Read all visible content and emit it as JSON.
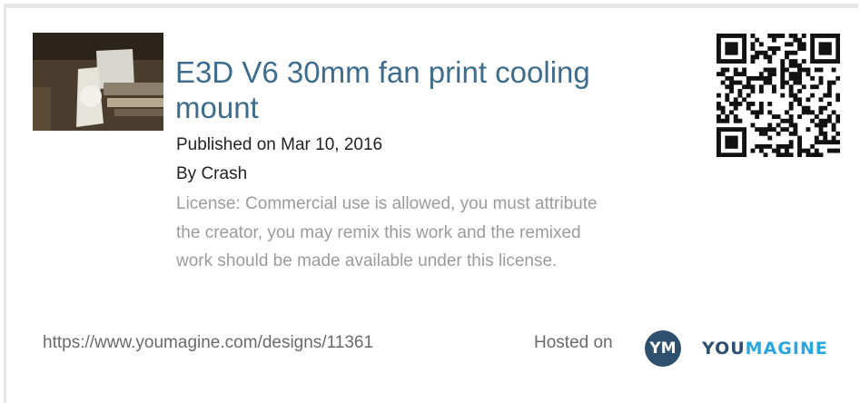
{
  "design": {
    "title": "E3D V6 30mm fan print cooling mount",
    "published": "Published on Mar 10, 2016",
    "author": "By Crash",
    "license": "License: Commercial use is allowed, you must attribute the creator, you may remix this work and the remixed work should be made available under this license.",
    "url": "https://www.youmagine.com/designs/11361"
  },
  "footer": {
    "hosted_on": "Hosted on",
    "logo_mark": "YM",
    "logo_word_part1": "YOU",
    "logo_word_part2": "MAGINE"
  },
  "colors": {
    "title": "#3d6c8c",
    "logo_dark": "#2f4f6f",
    "logo_accent": "#2aa7df",
    "muted_text": "#9b9b9b"
  },
  "icons": [
    "design-thumbnail-image",
    "qr-code-icon",
    "youmagine-logo"
  ]
}
